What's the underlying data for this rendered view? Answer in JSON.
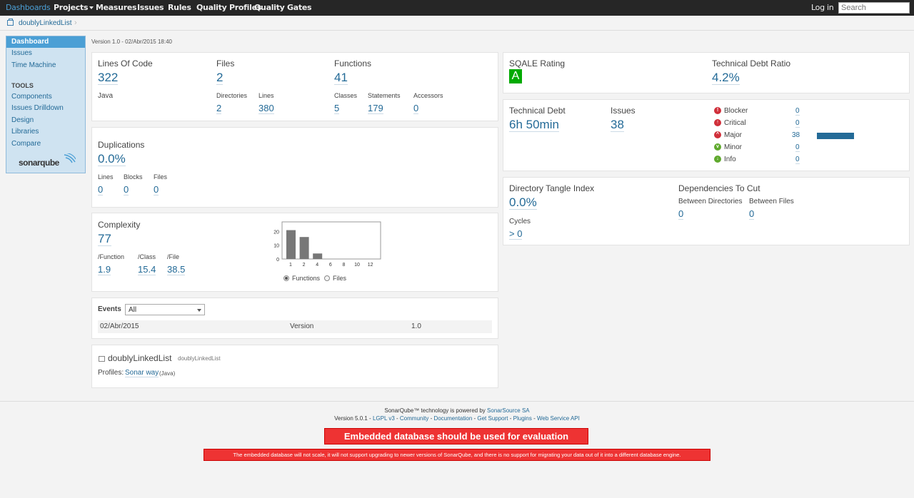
{
  "nav": {
    "items": [
      "Dashboards",
      "Projects",
      "Measures",
      "Issues",
      "Rules",
      "Quality Profiles",
      "Quality Gates"
    ],
    "login": "Log in",
    "search_placeholder": "Search"
  },
  "breadcrumb": {
    "project": "doublyLinkedList"
  },
  "sidebar": {
    "items": [
      "Dashboard",
      "Issues",
      "Time Machine"
    ],
    "tools_heading": "TOOLS",
    "tools": [
      "Components",
      "Issues Drilldown",
      "Design",
      "Libraries",
      "Compare"
    ],
    "logo": "sonarqube"
  },
  "version_line": "Version 1.0 - 02/Abr/2015 18:40",
  "size": {
    "loc_label": "Lines Of Code",
    "loc": "322",
    "language": "Java",
    "files_label": "Files",
    "files": "2",
    "directories_label": "Directories",
    "directories": "2",
    "lines_label": "Lines",
    "lines": "380",
    "functions_label": "Functions",
    "functions": "41",
    "classes_label": "Classes",
    "classes": "5",
    "statements_label": "Statements",
    "statements": "179",
    "accessors_label": "Accessors",
    "accessors": "0"
  },
  "duplications": {
    "label": "Duplications",
    "value": "0.0%",
    "lines_label": "Lines",
    "lines": "0",
    "blocks_label": "Blocks",
    "blocks": "0",
    "files_label": "Files",
    "files": "0"
  },
  "complexity": {
    "label": "Complexity",
    "value": "77",
    "per_function_label": "/Function",
    "per_function": "1.9",
    "per_class_label": "/Class",
    "per_class": "15.4",
    "per_file_label": "/File",
    "per_file": "38.5",
    "radio_functions": "Functions",
    "radio_files": "Files"
  },
  "chart_data": {
    "type": "bar",
    "categories": [
      "1",
      "2",
      "4",
      "6",
      "8",
      "10",
      "12"
    ],
    "values": [
      21,
      16,
      4,
      0,
      0,
      0,
      0
    ],
    "ylim": [
      0,
      27
    ],
    "y_ticks": [
      "20",
      "10",
      "0"
    ],
    "grid": false
  },
  "events": {
    "label": "Events",
    "filter": "All",
    "rows": [
      {
        "date": "02/Abr/2015",
        "category": "Version",
        "name": "1.0"
      }
    ]
  },
  "project_info": {
    "name": "doublyLinkedList",
    "key": "doublyLinkedList",
    "profiles_label": "Profiles:",
    "profile": "Sonar way",
    "profile_lang": "(Java)"
  },
  "sqale": {
    "rating_label": "SQALE Rating",
    "rating": "A",
    "ratio_label": "Technical Debt Ratio",
    "ratio": "4.2%"
  },
  "debt": {
    "label": "Technical Debt",
    "value": "6h 50min",
    "issues_label": "Issues",
    "issues": "38",
    "severities": [
      {
        "name": "Blocker",
        "count": "0",
        "fraction": 0,
        "color": "#d02f3a",
        "icon": "blocker-icon"
      },
      {
        "name": "Critical",
        "count": "0",
        "fraction": 0,
        "color": "#d02f3a",
        "icon": "critical-icon"
      },
      {
        "name": "Major",
        "count": "38",
        "fraction": 1,
        "color": "#d02f3a",
        "icon": "major-icon"
      },
      {
        "name": "Minor",
        "count": "0",
        "fraction": 0,
        "color": "#5fa92d",
        "icon": "minor-icon"
      },
      {
        "name": "Info",
        "count": "0",
        "fraction": 0,
        "color": "#5fa92d",
        "icon": "info-icon"
      }
    ],
    "bar_color": "#236a97"
  },
  "tangle": {
    "label": "Directory Tangle Index",
    "value": "0.0%",
    "cycles_label": "Cycles",
    "cycles": "> 0",
    "deps_label": "Dependencies To Cut",
    "between_dirs_label": "Between Directories",
    "between_dirs": "0",
    "between_files_label": "Between Files",
    "between_files": "0"
  },
  "footer": {
    "powered": "SonarQube™ technology is powered by",
    "company": "SonarSource SA",
    "version": "Version 5.0.1 -",
    "links": [
      "LGPL v3",
      "Community",
      "Documentation",
      "Get Support",
      "Plugins",
      "Web Service API"
    ],
    "warning_title": "Embedded database should be used for evaluation purpose only",
    "warning_text": "The embedded database will not scale, it will not support upgrading to newer versions of SonarQube, and there is no support for migrating your data out of it into a different database engine."
  }
}
